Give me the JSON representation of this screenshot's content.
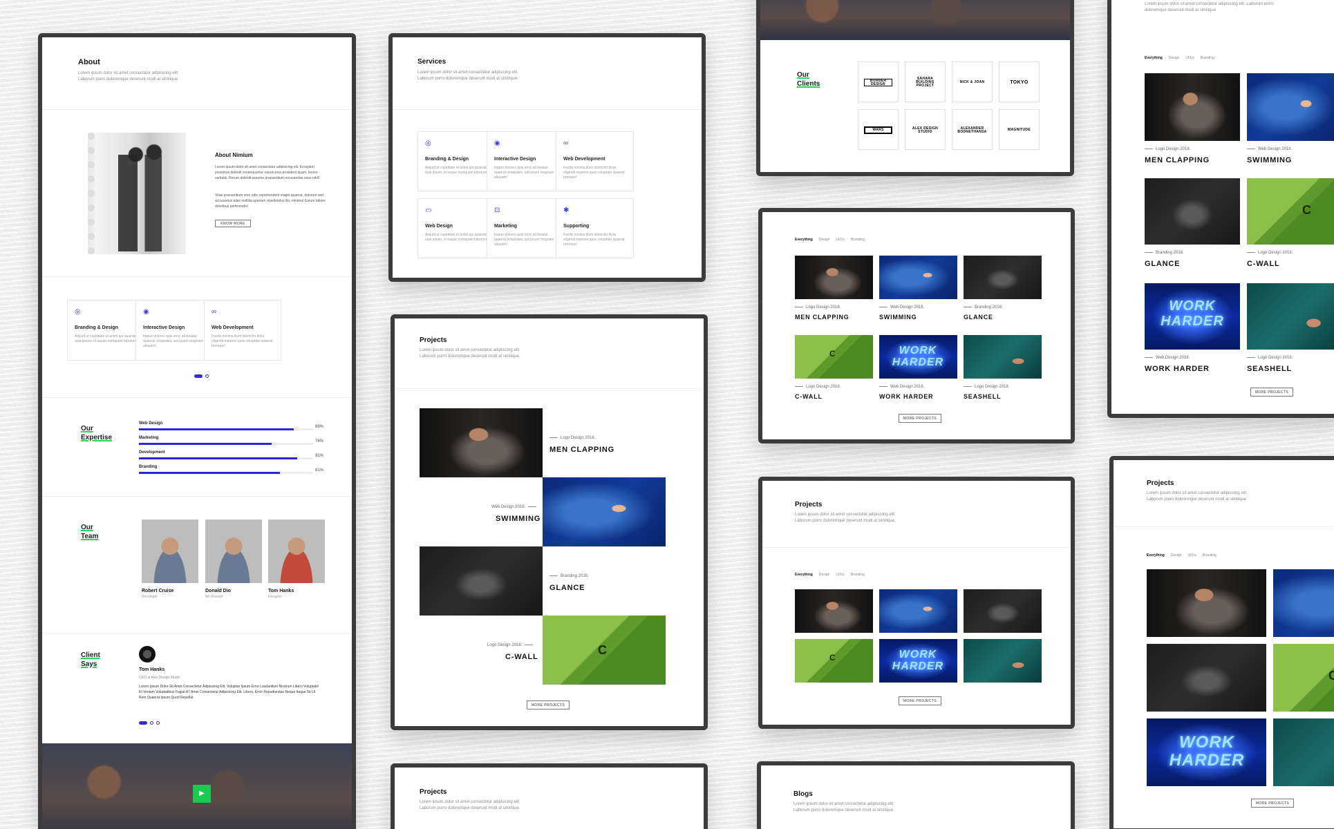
{
  "lorem": "Lorem ipsum dolor sit amet consectetur adipisicing elit. Laborum porro doloremque deserunt modi at similique.",
  "about": {
    "title": "About",
    "heading": "About Nimium",
    "body1": "Lorem ipsum dolor sit amet consectetur adipisicing elit. Excepturi possimus deleniti consequuntur earum eius provident quam, facere veritatis. Rerum deleniti assume praesentium recusandae esse nihil!",
    "body2": "Vitae praesentium vero odio reprehenderit magni quaerat, dolorum sed accusamus alias mollitia aperiam repellendus illo, minima! Earum labore doloribus perferendis!",
    "button": "Know More"
  },
  "services": {
    "title": "Services",
    "items": [
      {
        "icon": "branding-icon",
        "glyph": "◎",
        "title": "Branding & Design",
        "desc": "Aliquid ut cupiditate et animi qui quaerat quia ipsum, id eaque numquam laborum!"
      },
      {
        "icon": "eye-icon",
        "glyph": "◉",
        "title": "Interactive Design",
        "desc": "Itaque dolores quis error ad beatae quaerat voluptates, aut ipsum magnam aliquam!"
      },
      {
        "icon": "infinity-icon",
        "glyph": "∞",
        "title": "Web Development",
        "desc": "Facilis minima illum distinctio dicta eligendi maiores quos voluptate quaerat remrepe!"
      },
      {
        "icon": "monitor-icon",
        "glyph": "▭",
        "title": "Web Design",
        "desc": "Aliquid ut cupiditate et animi qui quaerat quia ipsum, id eaque numquam laborum!"
      },
      {
        "icon": "briefcase-icon",
        "glyph": "⊡",
        "title": "Marketing",
        "desc": "Itaque dolores quis error ad beatae quaerat voluptates, aut ipsum magnam aliquam!"
      },
      {
        "icon": "person-icon",
        "glyph": "✱",
        "title": "Supporting",
        "desc": "Facilis minima illum distinctio dicta eligendi maiores quos voluptate quaerat remrepe!"
      }
    ]
  },
  "expertise": {
    "title": "Our Expertise",
    "skills": [
      {
        "name": "Web Design",
        "percent": 89,
        "label": "89%"
      },
      {
        "name": "Marketing",
        "percent": 76,
        "label": "76%"
      },
      {
        "name": "Development",
        "percent": 91,
        "label": "91%"
      },
      {
        "name": "Branding",
        "percent": 81,
        "label": "81%"
      }
    ]
  },
  "team": {
    "title": "Our Team",
    "members": [
      {
        "name": "Robert Cruise",
        "role": "Developer"
      },
      {
        "name": "Donald Dio",
        "role": "Art Director"
      },
      {
        "name": "Tom Hanks",
        "role": "Designer"
      }
    ]
  },
  "client": {
    "title": "Client Says",
    "name": "Tom Hanks",
    "role": "CEO at Alex Design Studio",
    "quote": "Lorem Ipsum Dolor Sit Amet Consectetur Adipisicing Elit. Voluptas Ipsum Error Laudantium Nostrum Libero Voluptate! Et Veniam Voluptatibus Fugiat A? Amet Consectetur Adipisicing Elit. Libero, Error Repudiandae Neque Itaque Sit Ut Rem Quaerat Ipsum Quod Repellat."
  },
  "clients": {
    "title": "Our Clients",
    "logos": [
      "BORDER DESIGN",
      "SAHARA BUILDING PROJECT",
      "NICK & JOAN",
      "TOKYO",
      "WARS",
      "ALEX DESIGN STUDIO",
      "ALEXANDER BODNETHANSA",
      "MAGNITUDE"
    ]
  },
  "projects": {
    "title": "Projects",
    "filters": [
      "Everything",
      "Design",
      "UI/Ux",
      "Branding"
    ],
    "more": "More Projects",
    "items": [
      {
        "name": "MEN CLAPPING",
        "cat": "Logo Design 2018."
      },
      {
        "name": "SWIMMING",
        "cat": "Web Design 2018."
      },
      {
        "name": "GLANCE",
        "cat": "Branding 2018."
      },
      {
        "name": "C-WALL",
        "cat": "Logo Design 2018."
      },
      {
        "name": "WORK HARDER",
        "cat": "Web Design 2018."
      },
      {
        "name": "SEASHELL",
        "cat": "Logo Design 2018."
      }
    ]
  },
  "image_text": {
    "c": "C",
    "work1": "WORK HARDER",
    "work2": "WORK HARDER",
    "work3": "WORK HARDER",
    "work4": "WORK HARDER"
  },
  "blogs": {
    "title": "Blogs"
  },
  "play_glyph": "▶"
}
